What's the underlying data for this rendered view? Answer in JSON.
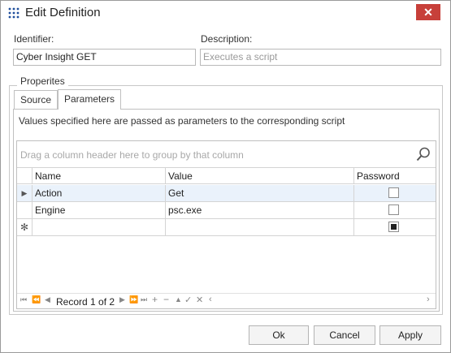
{
  "window": {
    "title": "Edit Definition",
    "close_label": "✕"
  },
  "form": {
    "identifier_label": "Identifier:",
    "identifier_value": "Cyber Insight GET",
    "description_label": "Description:",
    "description_placeholder": "Executes a script"
  },
  "group": {
    "legend": "Properites"
  },
  "tabs": [
    {
      "label": "Source",
      "active": false
    },
    {
      "label": "Parameters",
      "active": true
    }
  ],
  "parameters_tab": {
    "info": "Values specified here are passed as parameters to the corresponding script"
  },
  "grid": {
    "group_panel_text": "Drag a column header here to group by that column",
    "columns": [
      "Name",
      "Value",
      "Password"
    ],
    "rows": [
      {
        "name": "Action",
        "value": "Get",
        "password": false,
        "focused": true
      },
      {
        "name": "Engine",
        "value": "psc.exe",
        "password": false,
        "focused": false
      }
    ],
    "new_row": {
      "password": true
    },
    "navigator": {
      "record_text": "Record 1 of 2"
    }
  },
  "buttons": {
    "ok": "Ok",
    "cancel": "Cancel",
    "apply": "Apply"
  },
  "colors": {
    "close": "#c7403a",
    "focused_row": "#eaf2fb",
    "app_icon": "#1f4e9c"
  }
}
